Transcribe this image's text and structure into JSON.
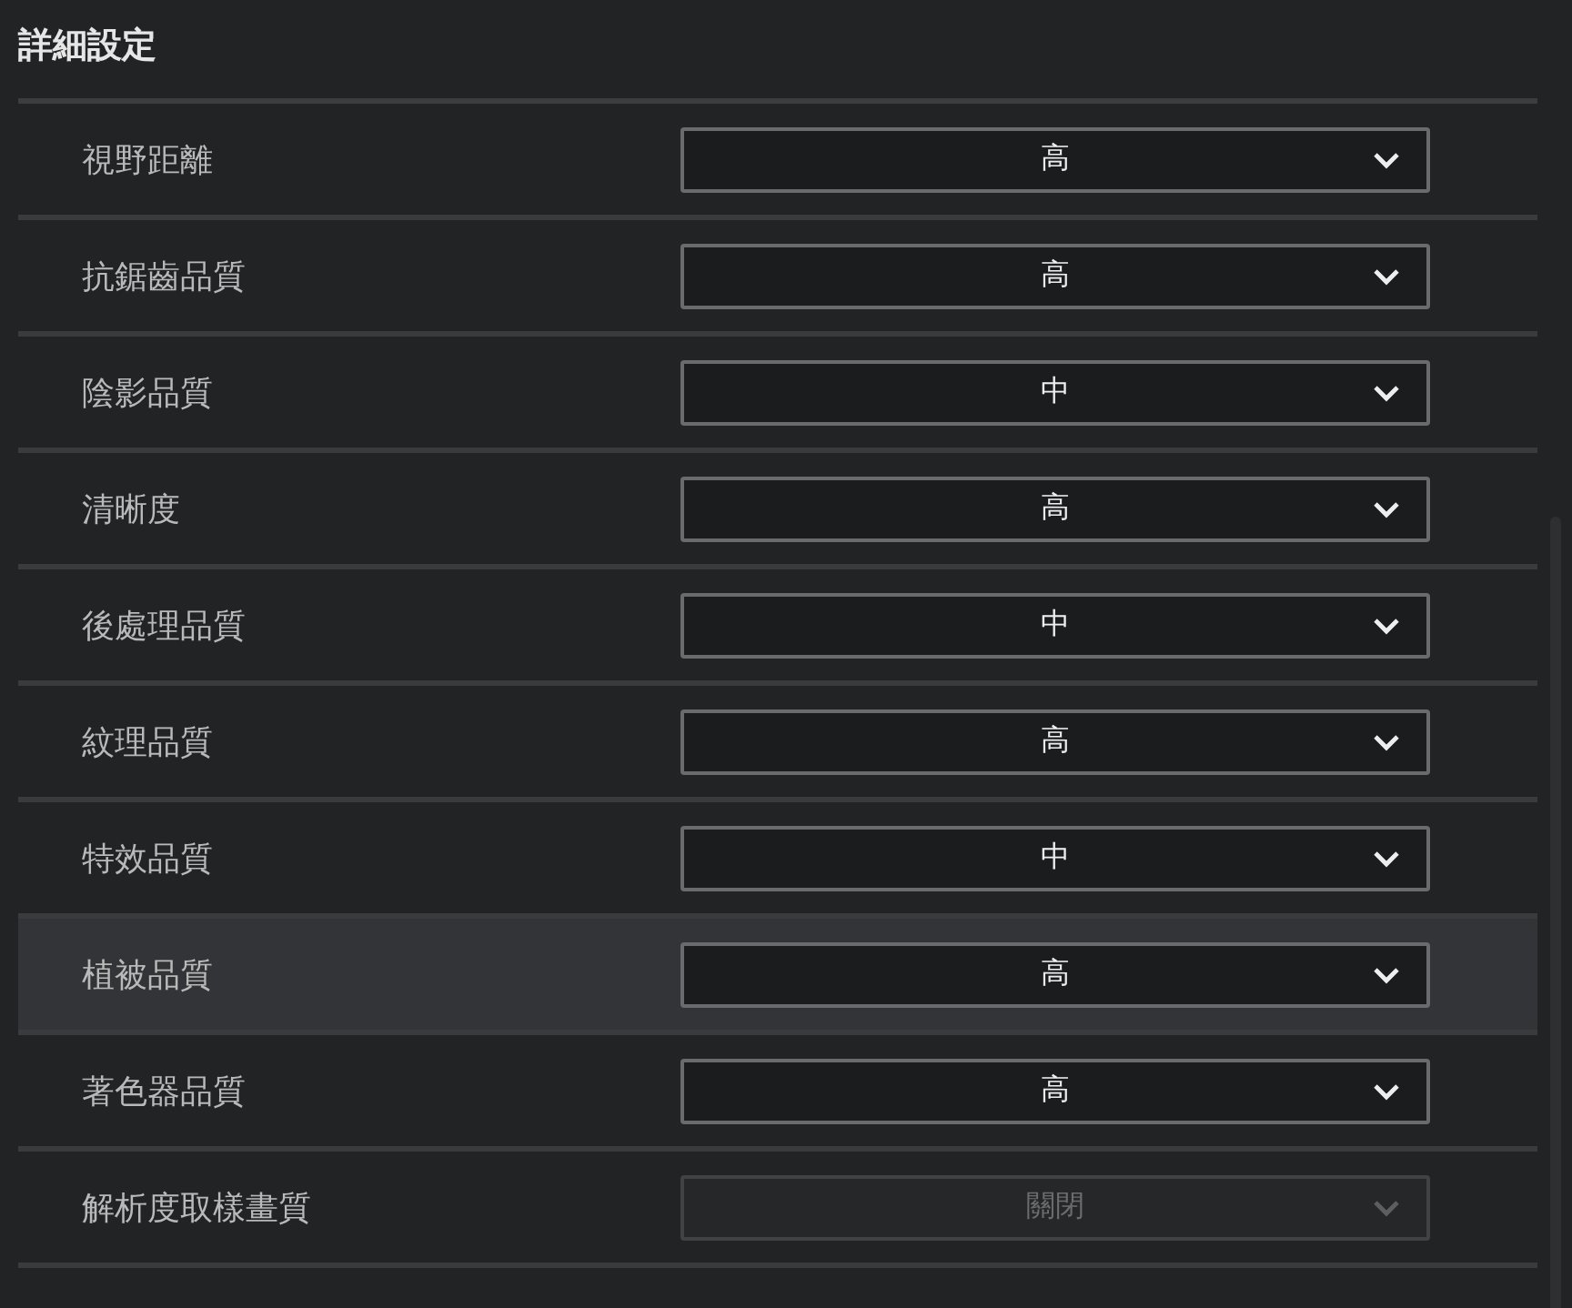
{
  "title": "詳細設定",
  "settings": [
    {
      "label": "視野距離",
      "value": "高",
      "highlighted": false,
      "disabled": false
    },
    {
      "label": "抗鋸齒品質",
      "value": "高",
      "highlighted": false,
      "disabled": false
    },
    {
      "label": "陰影品質",
      "value": "中",
      "highlighted": false,
      "disabled": false
    },
    {
      "label": "清晰度",
      "value": "高",
      "highlighted": false,
      "disabled": false
    },
    {
      "label": "後處理品質",
      "value": "中",
      "highlighted": false,
      "disabled": false
    },
    {
      "label": "紋理品質",
      "value": "高",
      "highlighted": false,
      "disabled": false
    },
    {
      "label": "特效品質",
      "value": "中",
      "highlighted": false,
      "disabled": false
    },
    {
      "label": "植被品質",
      "value": "高",
      "highlighted": true,
      "disabled": false
    },
    {
      "label": "著色器品質",
      "value": "高",
      "highlighted": false,
      "disabled": false
    },
    {
      "label": "解析度取樣畫質",
      "value": "關閉",
      "highlighted": false,
      "disabled": true
    }
  ]
}
